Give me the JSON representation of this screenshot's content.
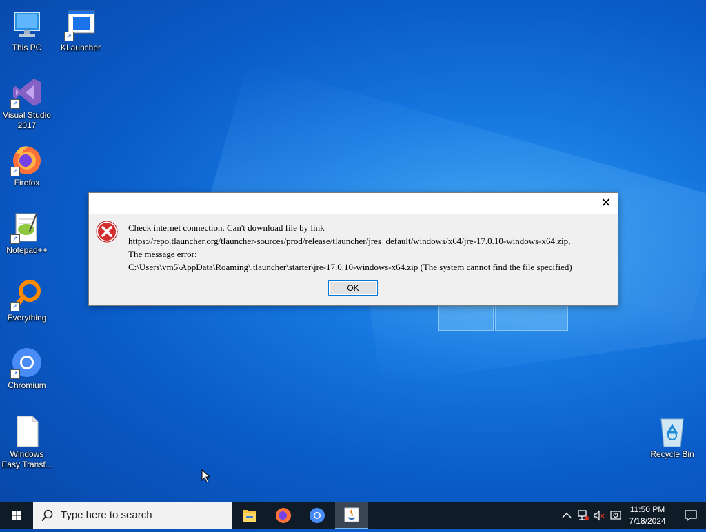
{
  "desktop": {
    "icons": [
      {
        "label": "This PC"
      },
      {
        "label": "KLauncher"
      },
      {
        "label": "Visual Studio 2017"
      },
      {
        "label": "Firefox"
      },
      {
        "label": "Notepad++"
      },
      {
        "label": "Everything"
      },
      {
        "label": "Chromium"
      },
      {
        "label": "Windows Easy Transf..."
      },
      {
        "label": "Recycle Bin"
      }
    ]
  },
  "dialog": {
    "close_glyph": "✕",
    "icon": "error-icon",
    "message_lines": [
      "Check internet connection. Can't download file by link",
      "https://repo.tlauncher.org/tlauncher-sources/prod/release/tlauncher/jres_default/windows/x64/jre-17.0.10-windows-x64.zip,",
      "The message error:",
      "C:\\Users\\vm5\\AppData\\Roaming\\.tlauncher\\starter\\jre-17.0.10-windows-x64.zip (The system cannot find the file specified)"
    ],
    "ok_label": "OK"
  },
  "taskbar": {
    "search_placeholder": "Type here to search",
    "pinned": [
      "file-explorer-icon",
      "firefox-icon",
      "chromium-icon",
      "java-app-icon"
    ],
    "clock": {
      "time": "11:50 PM",
      "date": "7/18/2024"
    }
  },
  "colors": {
    "accent": "#0078d7",
    "taskbar": "#101b28",
    "error": "#d32f2f"
  }
}
